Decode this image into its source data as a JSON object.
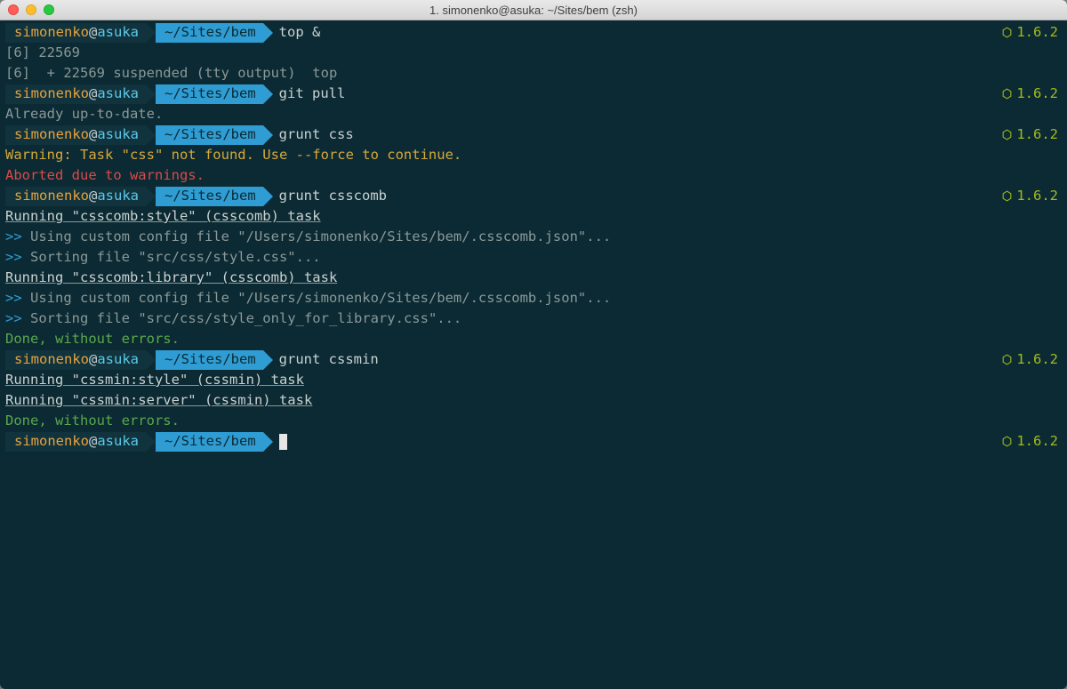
{
  "window": {
    "title": "1. simonenko@asuka: ~/Sites/bem (zsh)"
  },
  "prompt": {
    "user": "simonenko",
    "at": "@",
    "host": "asuka",
    "path": "~/Sites/bem",
    "version": "1.6.2"
  },
  "blocks": [
    {
      "command": "top &",
      "output_plain": [
        "[6] 22569",
        "[6]  + 22569 suspended (tty output)  top"
      ]
    },
    {
      "command": "git pull",
      "output_plain": [
        "Already up-to-date."
      ]
    },
    {
      "command": "grunt css",
      "output_styled": [
        {
          "cls": "yellow",
          "text": "Warning: Task \"css\" not found. Use --force to continue."
        },
        {
          "cls": "",
          "text": ""
        },
        {
          "cls": "red",
          "text": "Aborted due to warnings."
        }
      ]
    },
    {
      "command": "grunt csscomb",
      "running": [
        {
          "header": "Running \"csscomb:style\" (csscomb) task",
          "lines": [
            "Using custom config file \"/Users/simonenko/Sites/bem/.csscomb.json\"...",
            "Sorting file \"src/css/style.css\"..."
          ]
        },
        {
          "header": "Running \"csscomb:library\" (csscomb) task",
          "lines": [
            "Using custom config file \"/Users/simonenko/Sites/bem/.csscomb.json\"...",
            "Sorting file \"src/css/style_only_for_library.css\"..."
          ]
        }
      ],
      "done": "Done, without errors."
    },
    {
      "command": "grunt cssmin",
      "running": [
        {
          "header": "Running \"cssmin:style\" (cssmin) task",
          "lines": []
        },
        {
          "header": "Running \"cssmin:server\" (cssmin) task",
          "lines": []
        }
      ],
      "done": "Done, without errors."
    },
    {
      "command": "",
      "cursor": true
    }
  ],
  "arrows": ">>"
}
